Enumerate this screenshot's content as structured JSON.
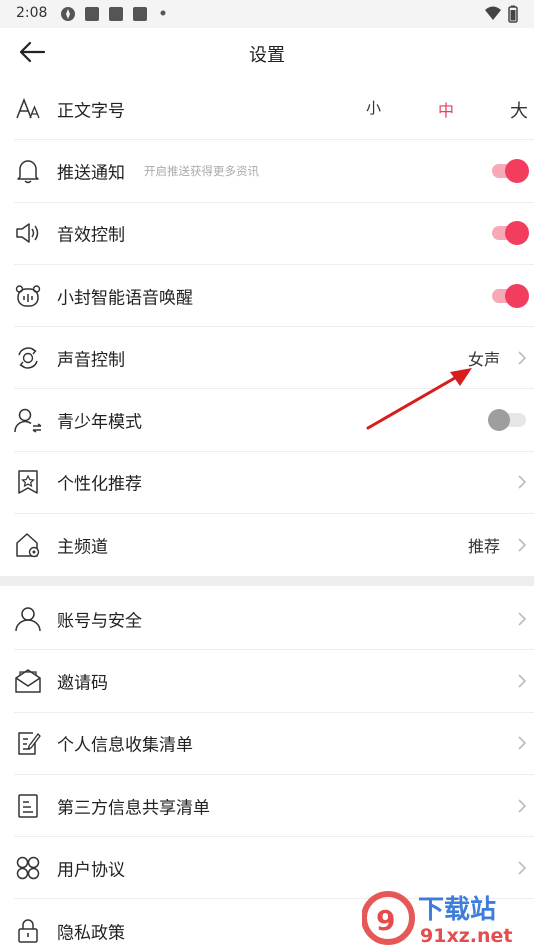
{
  "status_bar": {
    "time": "2:08"
  },
  "header": {
    "title": "设置"
  },
  "font_size": {
    "label": "正文字号",
    "options": [
      "小",
      "中",
      "大"
    ],
    "selected": "中",
    "accent_color": "#f23d5f"
  },
  "rows": {
    "push": {
      "label": "推送通知",
      "hint": "开启推送获得更多资讯",
      "on": true
    },
    "sound_fx": {
      "label": "音效控制",
      "on": true
    },
    "voice_wake": {
      "label": "小封智能语音唤醒",
      "on": true
    },
    "voice_control": {
      "label": "声音控制",
      "value": "女声"
    },
    "youth_mode": {
      "label": "青少年模式",
      "on": false
    },
    "personalized": {
      "label": "个性化推荐"
    },
    "main_channel": {
      "label": "主频道",
      "value": "推荐"
    },
    "account": {
      "label": "账号与安全"
    },
    "invite": {
      "label": "邀请码"
    },
    "personal_info": {
      "label": "个人信息收集清单"
    },
    "third_party": {
      "label": "第三方信息共享清单"
    },
    "user_agreement": {
      "label": "用户协议"
    },
    "privacy": {
      "label": "隐私政策"
    }
  },
  "watermark": {
    "brand": "下载站",
    "domain": "91xz.net"
  }
}
